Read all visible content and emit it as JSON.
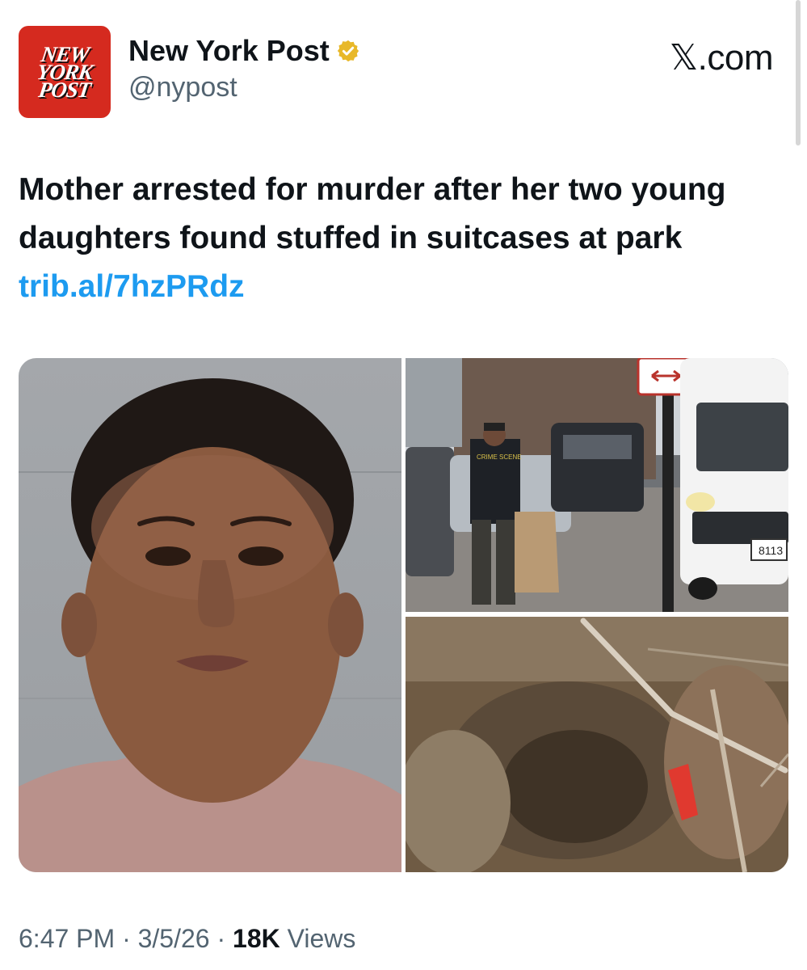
{
  "account": {
    "logo_lines": [
      "NEW",
      "YORK",
      "POST"
    ],
    "display_name": "New York Post",
    "handle": "@nypost",
    "verified_icon": "gold-check-badge-icon"
  },
  "source_label": "𝕏.com",
  "post": {
    "text": "Mother arrested for murder after her two young daughters found stuffed in suitcases at park",
    "link": "trib.al/7hzPRdz"
  },
  "media": {
    "right_top_sign_number": "8113",
    "jacket_text": "CRIME SCENE"
  },
  "meta": {
    "time": "6:47 PM",
    "date": "3/5/26",
    "views_count": "18K",
    "views_label": "Views",
    "separator": "·"
  },
  "colors": {
    "brand_red": "#d52a1f",
    "link_blue": "#1d9bf0",
    "muted_text": "#536471",
    "verified_gold": "#e8b829"
  }
}
